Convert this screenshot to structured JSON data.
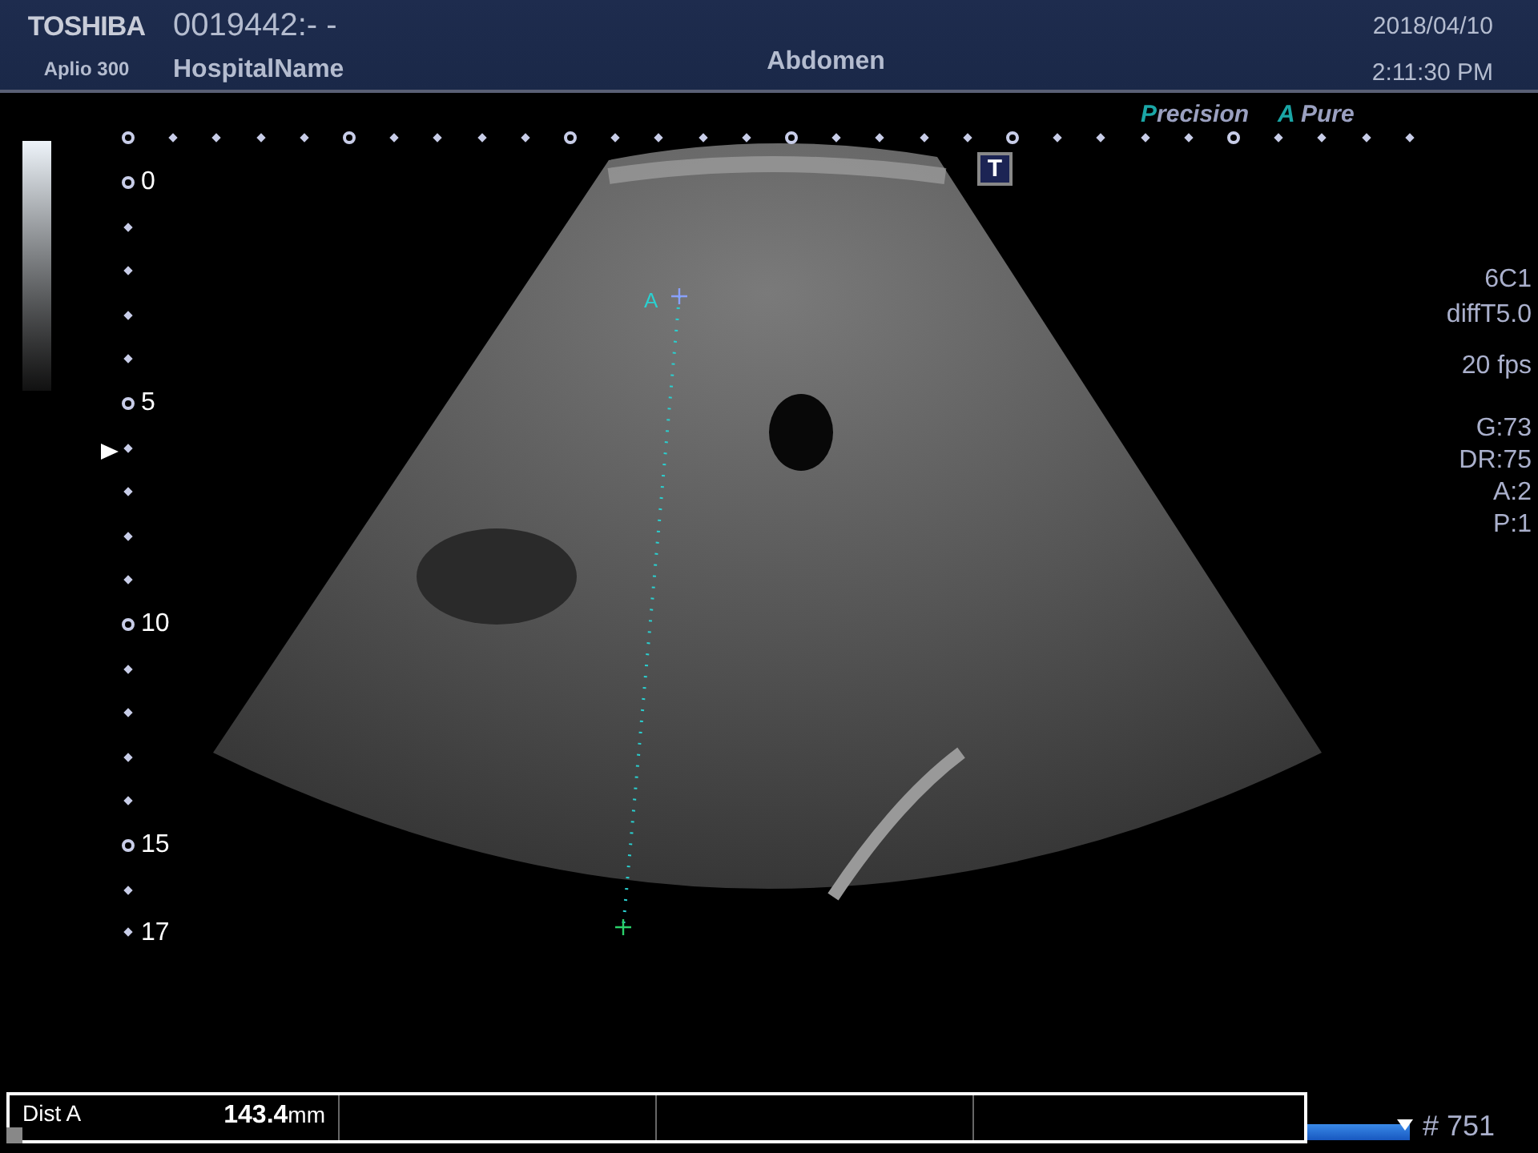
{
  "header": {
    "brand": "TOSHIBA",
    "model": "Aplio 300",
    "patient_id": "0019442:- -",
    "hospital": "HospitalName",
    "preset": "Abdomen",
    "date": "2018/04/10",
    "time": "2:11:30 PM"
  },
  "modes": [
    {
      "accent": "P",
      "rest": "recision"
    },
    {
      "accent": "A",
      "rest": "Pure"
    }
  ],
  "t_button": "T",
  "depth_labels": [
    "0",
    "5",
    "10",
    "15",
    "17"
  ],
  "param_groups": [
    [
      "6C1",
      "diffT5.0"
    ],
    [
      "20 fps"
    ],
    [
      "G:73",
      "DR:75",
      "A:2",
      "P:1"
    ]
  ],
  "caliper": {
    "label": "A"
  },
  "measurement": {
    "label": "Dist A",
    "value": "143.4",
    "unit": "mm"
  },
  "cine": {
    "level": 1,
    "frame": "# 751"
  }
}
